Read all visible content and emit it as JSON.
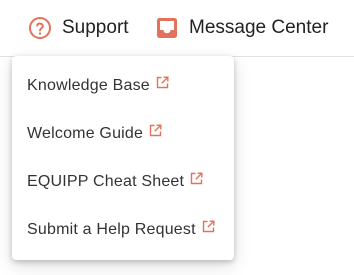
{
  "colors": {
    "accent": "#e2725b",
    "text": "#222222",
    "menu_text": "#333333"
  },
  "topbar": {
    "support": {
      "label": "Support",
      "icon": "help-circle-icon"
    },
    "message_center": {
      "label": "Message Center",
      "icon": "inbox-icon"
    }
  },
  "dropdown": {
    "items": [
      {
        "label": "Knowledge Base",
        "icon": "external-link-icon"
      },
      {
        "label": "Welcome Guide",
        "icon": "external-link-icon"
      },
      {
        "label": "EQUIPP Cheat Sheet",
        "icon": "external-link-icon"
      },
      {
        "label": "Submit a Help Request",
        "icon": "external-link-icon"
      }
    ]
  }
}
